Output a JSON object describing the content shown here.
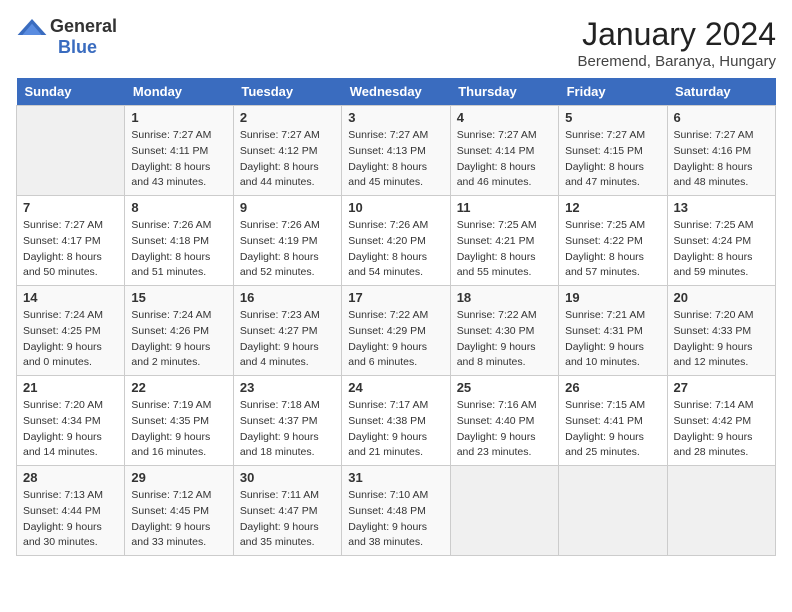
{
  "logo": {
    "general": "General",
    "blue": "Blue"
  },
  "title": "January 2024",
  "subtitle": "Beremend, Baranya, Hungary",
  "days_of_week": [
    "Sunday",
    "Monday",
    "Tuesday",
    "Wednesday",
    "Thursday",
    "Friday",
    "Saturday"
  ],
  "weeks": [
    [
      {
        "day": "",
        "sunrise": "",
        "sunset": "",
        "daylight": ""
      },
      {
        "day": "1",
        "sunrise": "Sunrise: 7:27 AM",
        "sunset": "Sunset: 4:11 PM",
        "daylight": "Daylight: 8 hours and 43 minutes."
      },
      {
        "day": "2",
        "sunrise": "Sunrise: 7:27 AM",
        "sunset": "Sunset: 4:12 PM",
        "daylight": "Daylight: 8 hours and 44 minutes."
      },
      {
        "day": "3",
        "sunrise": "Sunrise: 7:27 AM",
        "sunset": "Sunset: 4:13 PM",
        "daylight": "Daylight: 8 hours and 45 minutes."
      },
      {
        "day": "4",
        "sunrise": "Sunrise: 7:27 AM",
        "sunset": "Sunset: 4:14 PM",
        "daylight": "Daylight: 8 hours and 46 minutes."
      },
      {
        "day": "5",
        "sunrise": "Sunrise: 7:27 AM",
        "sunset": "Sunset: 4:15 PM",
        "daylight": "Daylight: 8 hours and 47 minutes."
      },
      {
        "day": "6",
        "sunrise": "Sunrise: 7:27 AM",
        "sunset": "Sunset: 4:16 PM",
        "daylight": "Daylight: 8 hours and 48 minutes."
      }
    ],
    [
      {
        "day": "7",
        "sunrise": "Sunrise: 7:27 AM",
        "sunset": "Sunset: 4:17 PM",
        "daylight": "Daylight: 8 hours and 50 minutes."
      },
      {
        "day": "8",
        "sunrise": "Sunrise: 7:26 AM",
        "sunset": "Sunset: 4:18 PM",
        "daylight": "Daylight: 8 hours and 51 minutes."
      },
      {
        "day": "9",
        "sunrise": "Sunrise: 7:26 AM",
        "sunset": "Sunset: 4:19 PM",
        "daylight": "Daylight: 8 hours and 52 minutes."
      },
      {
        "day": "10",
        "sunrise": "Sunrise: 7:26 AM",
        "sunset": "Sunset: 4:20 PM",
        "daylight": "Daylight: 8 hours and 54 minutes."
      },
      {
        "day": "11",
        "sunrise": "Sunrise: 7:25 AM",
        "sunset": "Sunset: 4:21 PM",
        "daylight": "Daylight: 8 hours and 55 minutes."
      },
      {
        "day": "12",
        "sunrise": "Sunrise: 7:25 AM",
        "sunset": "Sunset: 4:22 PM",
        "daylight": "Daylight: 8 hours and 57 minutes."
      },
      {
        "day": "13",
        "sunrise": "Sunrise: 7:25 AM",
        "sunset": "Sunset: 4:24 PM",
        "daylight": "Daylight: 8 hours and 59 minutes."
      }
    ],
    [
      {
        "day": "14",
        "sunrise": "Sunrise: 7:24 AM",
        "sunset": "Sunset: 4:25 PM",
        "daylight": "Daylight: 9 hours and 0 minutes."
      },
      {
        "day": "15",
        "sunrise": "Sunrise: 7:24 AM",
        "sunset": "Sunset: 4:26 PM",
        "daylight": "Daylight: 9 hours and 2 minutes."
      },
      {
        "day": "16",
        "sunrise": "Sunrise: 7:23 AM",
        "sunset": "Sunset: 4:27 PM",
        "daylight": "Daylight: 9 hours and 4 minutes."
      },
      {
        "day": "17",
        "sunrise": "Sunrise: 7:22 AM",
        "sunset": "Sunset: 4:29 PM",
        "daylight": "Daylight: 9 hours and 6 minutes."
      },
      {
        "day": "18",
        "sunrise": "Sunrise: 7:22 AM",
        "sunset": "Sunset: 4:30 PM",
        "daylight": "Daylight: 9 hours and 8 minutes."
      },
      {
        "day": "19",
        "sunrise": "Sunrise: 7:21 AM",
        "sunset": "Sunset: 4:31 PM",
        "daylight": "Daylight: 9 hours and 10 minutes."
      },
      {
        "day": "20",
        "sunrise": "Sunrise: 7:20 AM",
        "sunset": "Sunset: 4:33 PM",
        "daylight": "Daylight: 9 hours and 12 minutes."
      }
    ],
    [
      {
        "day": "21",
        "sunrise": "Sunrise: 7:20 AM",
        "sunset": "Sunset: 4:34 PM",
        "daylight": "Daylight: 9 hours and 14 minutes."
      },
      {
        "day": "22",
        "sunrise": "Sunrise: 7:19 AM",
        "sunset": "Sunset: 4:35 PM",
        "daylight": "Daylight: 9 hours and 16 minutes."
      },
      {
        "day": "23",
        "sunrise": "Sunrise: 7:18 AM",
        "sunset": "Sunset: 4:37 PM",
        "daylight": "Daylight: 9 hours and 18 minutes."
      },
      {
        "day": "24",
        "sunrise": "Sunrise: 7:17 AM",
        "sunset": "Sunset: 4:38 PM",
        "daylight": "Daylight: 9 hours and 21 minutes."
      },
      {
        "day": "25",
        "sunrise": "Sunrise: 7:16 AM",
        "sunset": "Sunset: 4:40 PM",
        "daylight": "Daylight: 9 hours and 23 minutes."
      },
      {
        "day": "26",
        "sunrise": "Sunrise: 7:15 AM",
        "sunset": "Sunset: 4:41 PM",
        "daylight": "Daylight: 9 hours and 25 minutes."
      },
      {
        "day": "27",
        "sunrise": "Sunrise: 7:14 AM",
        "sunset": "Sunset: 4:42 PM",
        "daylight": "Daylight: 9 hours and 28 minutes."
      }
    ],
    [
      {
        "day": "28",
        "sunrise": "Sunrise: 7:13 AM",
        "sunset": "Sunset: 4:44 PM",
        "daylight": "Daylight: 9 hours and 30 minutes."
      },
      {
        "day": "29",
        "sunrise": "Sunrise: 7:12 AM",
        "sunset": "Sunset: 4:45 PM",
        "daylight": "Daylight: 9 hours and 33 minutes."
      },
      {
        "day": "30",
        "sunrise": "Sunrise: 7:11 AM",
        "sunset": "Sunset: 4:47 PM",
        "daylight": "Daylight: 9 hours and 35 minutes."
      },
      {
        "day": "31",
        "sunrise": "Sunrise: 7:10 AM",
        "sunset": "Sunset: 4:48 PM",
        "daylight": "Daylight: 9 hours and 38 minutes."
      },
      {
        "day": "",
        "sunrise": "",
        "sunset": "",
        "daylight": ""
      },
      {
        "day": "",
        "sunrise": "",
        "sunset": "",
        "daylight": ""
      },
      {
        "day": "",
        "sunrise": "",
        "sunset": "",
        "daylight": ""
      }
    ]
  ]
}
